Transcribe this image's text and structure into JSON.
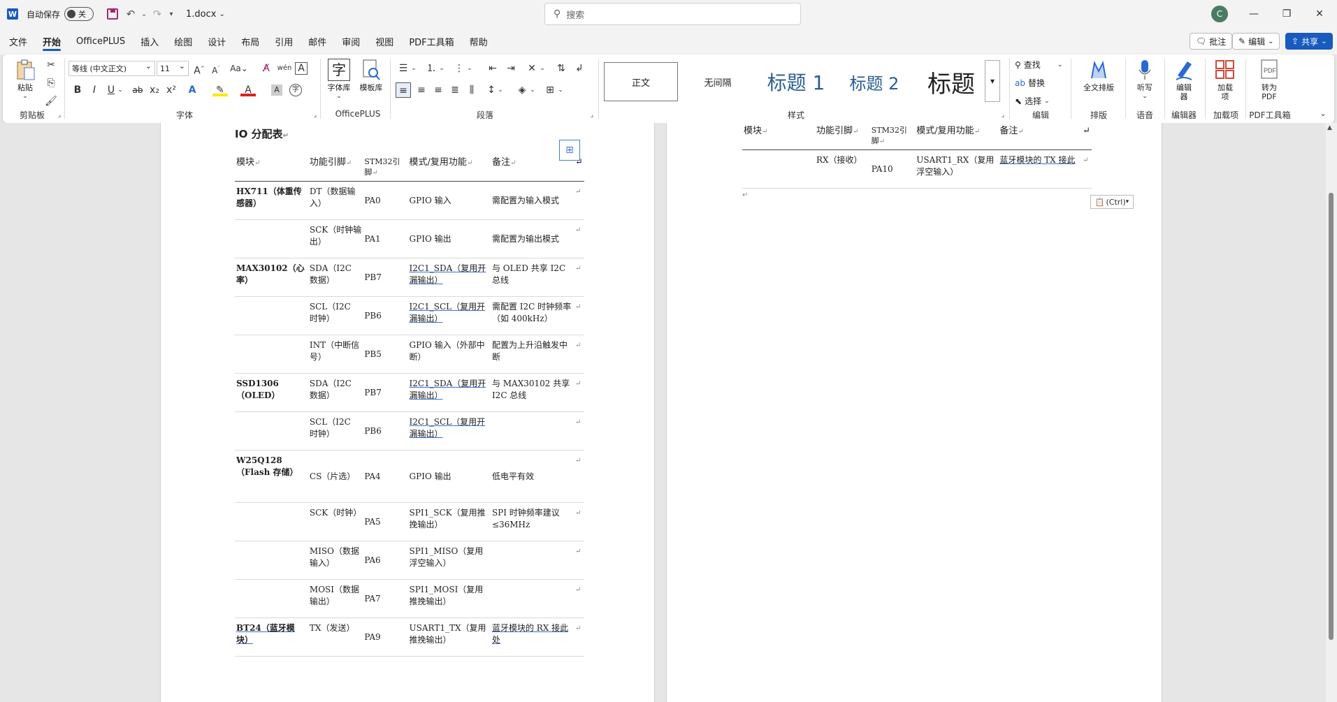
{
  "titlebar": {
    "app_logo": "W",
    "autosave_label": "自动保存",
    "autosave_state": "关",
    "filename": "1.docx",
    "search_placeholder": "搜索",
    "avatar_initial": "C"
  },
  "menu": {
    "items": [
      "文件",
      "开始",
      "OfficePLUS",
      "插入",
      "绘图",
      "设计",
      "布局",
      "引用",
      "邮件",
      "审阅",
      "视图",
      "PDF工具箱",
      "帮助"
    ],
    "active": "开始",
    "right_buttons": {
      "comment": "批注",
      "edit": "编辑",
      "share": "共享"
    }
  },
  "ribbon": {
    "groups": {
      "clipboard": "剪贴板",
      "font": "字体",
      "officeplus": "OfficePLUS",
      "paragraph": "段落",
      "styles": "样式",
      "editing": "编辑",
      "layout": "排版",
      "voice": "语音",
      "editor": "编辑器",
      "addins": "加载项",
      "pdftools": "PDF工具箱"
    },
    "paste_label": "粘贴",
    "font_name": "等线 (中文正文)",
    "font_size": "11",
    "font_buttons": {
      "bold": "B",
      "italic": "I",
      "underline": "U",
      "strike": "ab",
      "sub": "x₂",
      "sup": "x²"
    },
    "officeplus_buttons": {
      "font_lib": "字体库",
      "template_lib": "模板库"
    },
    "styles": [
      "正文",
      "无间隔",
      "标题 1",
      "标题 2",
      "标题"
    ],
    "editing": {
      "find": "查找",
      "replace": "替换",
      "select": "选择"
    },
    "layout_btn": "全文排版",
    "voice_btn": "听写",
    "editor_btn": "编辑器",
    "addin_btn": "加载项",
    "pdf_btn": "转为PDF"
  },
  "document": {
    "title": "IO 分配表",
    "headers": [
      "模块",
      "功能引脚",
      "STM32引脚",
      "模式/复用功能",
      "备注"
    ],
    "rows": [
      {
        "module": "HX711（体重传感器）",
        "func": "DT（数据输入）",
        "pin": "PA0",
        "mode": "GPIO 输入",
        "note": "需配置为输入模式"
      },
      {
        "module": "",
        "func": "SCK（时钟输出）",
        "pin": "PA1",
        "mode": "GPIO 输出",
        "note": "需配置为输出模式"
      },
      {
        "module": "MAX30102（心率）",
        "func": "SDA（I2C 数据）",
        "pin": "PB7",
        "mode": "I2C1_SDA（复用开漏输出）",
        "note": "与 OLED 共享 I2C 总线"
      },
      {
        "module": "",
        "func": "SCL（I2C 时钟）",
        "pin": "PB6",
        "mode": "I2C1_SCL（复用开漏输出）",
        "note": "需配置 I2C 时钟频率（如 400kHz）"
      },
      {
        "module": "",
        "func": "INT（中断信号）",
        "pin": "PB5",
        "mode": "GPIO 输入（外部中断）",
        "note": "配置为上升沿触发中断"
      },
      {
        "module": "SSD1306（OLED）",
        "func": "SDA（I2C 数据）",
        "pin": "PB7",
        "mode": "I2C1_SDA（复用开漏输出）",
        "note": "与 MAX30102 共享 I2C 总线"
      },
      {
        "module": "",
        "func": "SCL（I2C 时钟）",
        "pin": "PB6",
        "mode": "I2C1_SCL（复用开漏输出）",
        "note": ""
      },
      {
        "module": "W25Q128（Flash 存储）",
        "func": "CS（片选）",
        "pin": "PA4",
        "mode": "GPIO 输出",
        "note": "低电平有效"
      },
      {
        "module": "",
        "func": "SCK（时钟）",
        "pin": "PA5",
        "mode": "SPI1_SCK（复用推挽输出）",
        "note": "SPI 时钟频率建议≤36MHz"
      },
      {
        "module": "",
        "func": "MISO（数据输入）",
        "pin": "PA6",
        "mode": "SPI1_MISO（复用浮空输入）",
        "note": ""
      },
      {
        "module": "",
        "func": "MOSI（数据输出）",
        "pin": "PA7",
        "mode": "SPI1_MOSI（复用推挽输出）",
        "note": ""
      },
      {
        "module": "BT24（蓝牙模块）",
        "func": "TX（发送）",
        "pin": "PA9",
        "mode": "USART1_TX（复用推挽输出）",
        "note": "蓝牙模块的 RX 接此处"
      }
    ],
    "page2_rows": [
      {
        "module": "",
        "func": "RX（接收）",
        "pin": "PA10",
        "mode": "USART1_RX（复用浮空输入）",
        "note": "蓝牙模块的 TX 接此"
      }
    ],
    "paste_options": "(Ctrl)"
  }
}
